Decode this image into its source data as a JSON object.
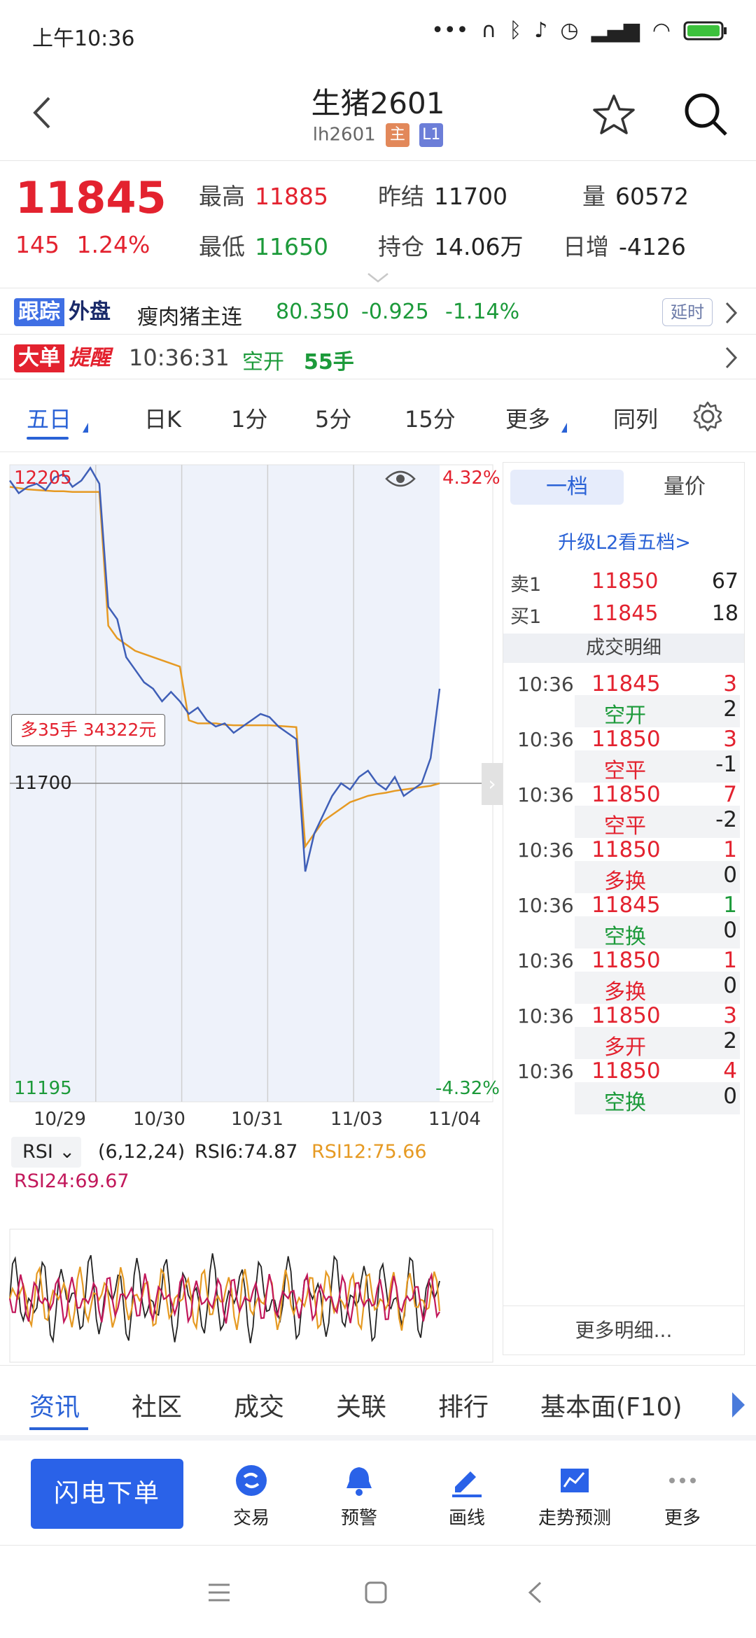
{
  "status_bar": {
    "time": "上午10:36",
    "icons": [
      "more-dots-icon",
      "headphones-icon",
      "bluetooth-icon",
      "mute-bell-icon",
      "alarm-icon",
      "signal-icon",
      "wifi-icon",
      "battery-icon"
    ]
  },
  "header": {
    "title": "生猪2601",
    "code": "lh2601",
    "tag_main": "主",
    "tag_level": "L1"
  },
  "quote": {
    "price": "11845",
    "change": "145",
    "change_pct": "1.24%",
    "high_label": "最高",
    "high": "11885",
    "low_label": "最低",
    "low": "11650",
    "prev_settle_label": "昨结",
    "prev_settle": "11700",
    "open_interest_label": "持仓",
    "open_interest": "14.06万",
    "volume_label": "量",
    "volume": "60572",
    "daily_inc_label": "日增",
    "daily_inc": "-4126"
  },
  "ticker": {
    "badge_a": "跟踪",
    "badge_b": "外盘",
    "name": "瘦肉猪主连",
    "price": "80.350",
    "change": "-0.925",
    "change_pct": "-1.14%",
    "delay_label": "延时"
  },
  "alert": {
    "badge_a": "大单",
    "badge_b": "提醒",
    "time": "10:36:31",
    "type": "空开",
    "qty": "55手"
  },
  "period_tabs": [
    {
      "label": "五日",
      "active": true
    },
    {
      "label": "日K"
    },
    {
      "label": "1分"
    },
    {
      "label": "5分"
    },
    {
      "label": "15分"
    },
    {
      "label": "更多"
    },
    {
      "label": "同列"
    }
  ],
  "chart": {
    "y_top": "12205",
    "y_bottom": "11195",
    "y_ref": "11700",
    "pct_top": "4.32%",
    "pct_bottom": "-4.32%",
    "position_tag": "多35手  34322元",
    "dates": [
      "10/29",
      "10/30",
      "10/31",
      "11/03",
      "11/04"
    ]
  },
  "chart_data": {
    "type": "line",
    "series": [
      {
        "name": "price",
        "values": [
          12180,
          12160,
          12170,
          12175,
          12165,
          12185,
          12190,
          12170,
          12180,
          12200,
          12175,
          11980,
          11960,
          11900,
          11880,
          11860,
          11850,
          11830,
          11845,
          11830,
          11810,
          11820,
          11800,
          11790,
          11795,
          11780,
          11790,
          11800,
          11810,
          11805,
          11790,
          11780,
          11770,
          11560,
          11620,
          11650,
          11680,
          11700,
          11690,
          11710,
          11720,
          11700,
          11690,
          11710,
          11680,
          11690,
          11700,
          11740,
          11850
        ]
      },
      {
        "name": "average",
        "values": [
          12170,
          12168,
          12166,
          12165,
          12164,
          12163,
          12163,
          12162,
          12162,
          12162,
          12162,
          11950,
          11930,
          11920,
          11910,
          11905,
          11900,
          11895,
          11890,
          11885,
          11800,
          11795,
          11795,
          11795,
          11793,
          11792,
          11792,
          11792,
          11792,
          11792,
          11791,
          11790,
          11789,
          11600,
          11620,
          11640,
          11650,
          11660,
          11670,
          11675,
          11680,
          11683,
          11685,
          11688,
          11690,
          11692,
          11694,
          11696,
          11700
        ]
      }
    ],
    "ylim": [
      11195,
      12205
    ],
    "reference_value": 11700,
    "days": [
      "10/29",
      "10/30",
      "10/31",
      "11/03",
      "11/04"
    ]
  },
  "rsi": {
    "indicator": "RSI",
    "params": "(6,12,24)",
    "rsi6": "RSI6:74.87",
    "rsi12": "RSI12:75.66",
    "rsi24": "RSI24:69.67"
  },
  "depth": {
    "tab_one": "一档",
    "tab_two": "量价",
    "upgrade": "升级L2看五档>",
    "sell_label": "卖1",
    "sell_price": "11850",
    "sell_vol": "67",
    "buy_label": "买1",
    "buy_price": "11845",
    "buy_vol": "18",
    "detail_title": "成交明细",
    "trades": [
      {
        "time": "10:36",
        "price": "11845",
        "vol": "3",
        "type": "空开",
        "delta": "2",
        "dir": "up",
        "type_color": "green"
      },
      {
        "time": "10:36",
        "price": "11850",
        "vol": "3",
        "type": "空平",
        "delta": "-1",
        "dir": "up",
        "type_color": "red"
      },
      {
        "time": "10:36",
        "price": "11850",
        "vol": "7",
        "type": "空平",
        "delta": "-2",
        "dir": "up",
        "type_color": "red"
      },
      {
        "time": "10:36",
        "price": "11850",
        "vol": "1",
        "type": "多换",
        "delta": "0",
        "dir": "up",
        "type_color": "red"
      },
      {
        "time": "10:36",
        "price": "11845",
        "vol": "1",
        "type": "空换",
        "delta": "0",
        "dir": "down",
        "type_color": "green"
      },
      {
        "time": "10:36",
        "price": "11850",
        "vol": "1",
        "type": "多换",
        "delta": "0",
        "dir": "up",
        "type_color": "red"
      },
      {
        "time": "10:36",
        "price": "11850",
        "vol": "3",
        "type": "多开",
        "delta": "2",
        "dir": "up",
        "type_color": "red"
      },
      {
        "time": "10:36",
        "price": "11850",
        "vol": "4",
        "type": "空换",
        "delta": "0",
        "dir": "up",
        "type_color": "green"
      }
    ],
    "more": "更多明细..."
  },
  "info_tabs": [
    {
      "label": "资讯",
      "active": true
    },
    {
      "label": "社区"
    },
    {
      "label": "成交"
    },
    {
      "label": "关联"
    },
    {
      "label": "排行"
    },
    {
      "label": "基本面(F10)"
    }
  ],
  "actions": {
    "flash_order": "闪电下单",
    "items": [
      {
        "label": "交易",
        "icon": "trade-icon"
      },
      {
        "label": "预警",
        "icon": "bell-icon"
      },
      {
        "label": "画线",
        "icon": "draw-line-icon"
      },
      {
        "label": "走势预测",
        "icon": "forecast-icon"
      },
      {
        "label": "更多",
        "icon": "more-icon"
      }
    ]
  },
  "colors": {
    "up": "#e3222f",
    "down": "#1c9a3a",
    "accent": "#2a62d6",
    "avg_line": "#e69a23",
    "price_line": "#3f5fb7"
  }
}
